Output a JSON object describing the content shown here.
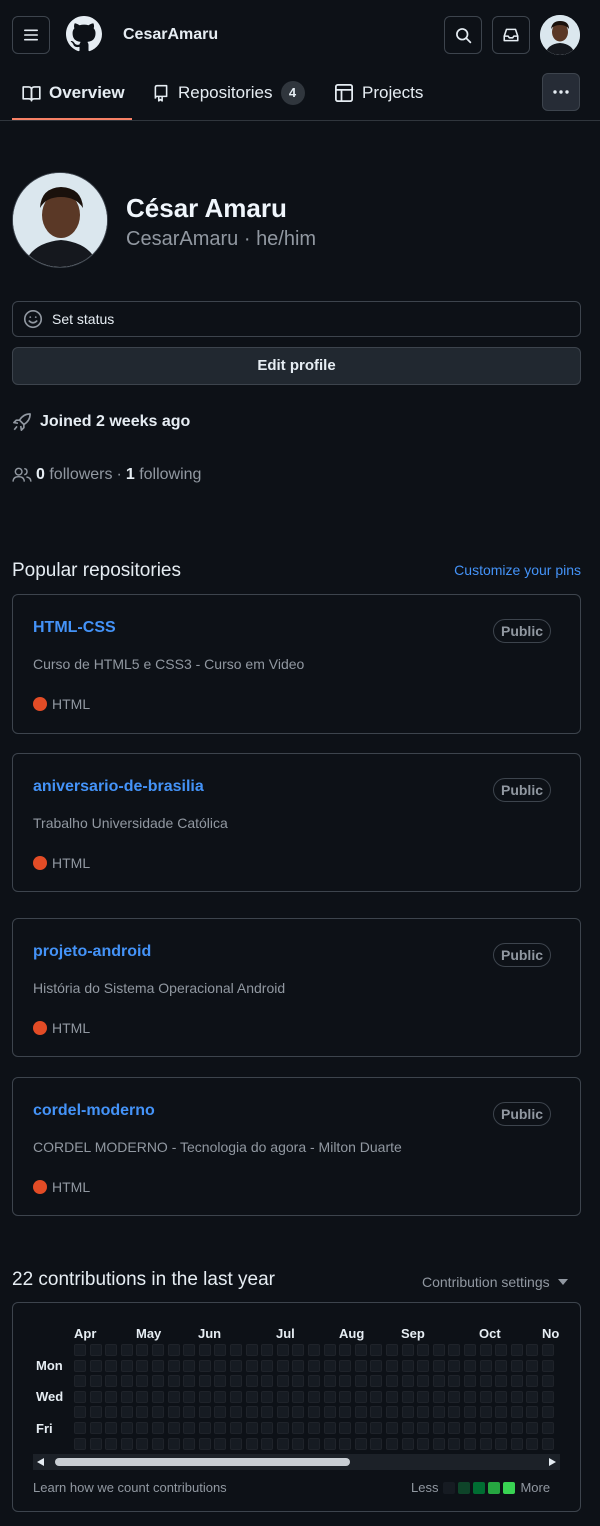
{
  "header": {
    "username": "CesarAmaru",
    "icons": [
      "hamburger-icon",
      "github-logo-icon",
      "search-icon",
      "inbox-icon"
    ]
  },
  "tabs": [
    {
      "label": "Overview",
      "icon": "book-icon",
      "active": true
    },
    {
      "label": "Repositories",
      "icon": "repo-icon",
      "count": "4"
    },
    {
      "label": "Projects",
      "icon": "table-icon"
    }
  ],
  "profile": {
    "name": "César Amaru",
    "login": "CesarAmaru",
    "pronouns": "he/him",
    "separator": "·",
    "set_status": "Set status",
    "edit_profile": "Edit profile",
    "joined": "Joined 2 weeks ago",
    "followers_count": "0",
    "followers_label": "followers",
    "dot": "·",
    "following_count": "1",
    "following_label": "following"
  },
  "popular": {
    "title": "Popular repositories",
    "customize": "Customize your pins",
    "repos": [
      {
        "name": "HTML-CSS",
        "visibility": "Public",
        "description": "Curso de HTML5 e CSS3 - Curso em Video",
        "language": "HTML"
      },
      {
        "name": "aniversario-de-brasilia",
        "visibility": "Public",
        "description": "Trabalho Universidade Católica",
        "language": "HTML"
      },
      {
        "name": "projeto-android",
        "visibility": "Public",
        "description": "História do Sistema Operacional Android",
        "language": "HTML"
      },
      {
        "name": "cordel-moderno",
        "visibility": "Public",
        "description": "CORDEL MODERNO - Tecnologia do agora - Milton Duarte",
        "language": "HTML"
      }
    ],
    "language_color": "#e34c26"
  },
  "contributions": {
    "title": "22 contributions in the last year",
    "settings": "Contribution settings",
    "months": [
      "Apr",
      "May",
      "Jun",
      "Jul",
      "Aug",
      "Sep",
      "Oct",
      "No"
    ],
    "days": [
      "Mon",
      "Wed",
      "Fri"
    ],
    "learn_link": "Learn how we count contributions",
    "less": "Less",
    "more": "More",
    "legend_colors": [
      "#161b22",
      "#0e4429",
      "#006d32",
      "#26a641",
      "#39d353"
    ]
  }
}
